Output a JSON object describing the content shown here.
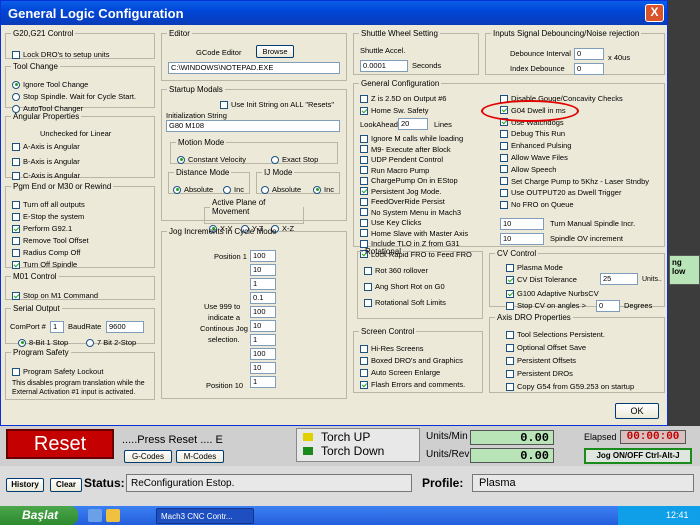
{
  "title": "General Logic Configuration",
  "close_label": "X",
  "g20": {
    "legend": "G20,G21 Control",
    "lock_dro": "Lock DRO's to setup units"
  },
  "toolchange": {
    "legend": "Tool Change",
    "ignore": "Ignore Tool Change",
    "stop": "Stop Spindle. Wait for Cycle Start.",
    "auto": "AutoTool Changer"
  },
  "angular": {
    "legend": "Angular Properties",
    "note": "Unchecked for Linear",
    "a": "A-Axis is Angular",
    "b": "B-Axis is Angular",
    "c": "C-Axis is Angular"
  },
  "pgmend": {
    "legend": "Pgm End or M30 or Rewind",
    "items": [
      "Turn off all outputs",
      "E-Stop the system",
      "Perform G92.1",
      "Remove Tool Offset",
      "Radius Comp Off",
      "Turn Off Spindle"
    ]
  },
  "m01": {
    "legend": "M01 Control",
    "stop": "Stop on M1 Command"
  },
  "serial": {
    "legend": "Serial Output",
    "comport_label": "ComPort #",
    "comport": "1",
    "baud_label": "BaudRate",
    "baud": "9600",
    "bit8": "8-Bit 1 Stop",
    "bit7": "7 Bit 2-Stop"
  },
  "safety": {
    "legend": "Program Safety",
    "lockout": "Program Safety Lockout",
    "desc1": "This disables program translation while the",
    "desc2": "External Activation #1 input is activated."
  },
  "editor": {
    "legend": "Editor",
    "label": "GCode Editor",
    "browse": "Browse",
    "path": "C:\\WINDOWS\\NOTEPAD.EXE"
  },
  "startup": {
    "legend": "Startup Modals",
    "use_init": "Use Init String on ALL \"Resets\"",
    "init_label": "Initialization String",
    "init_value": "G80 M108"
  },
  "motion": {
    "legend": "Motion Mode",
    "cv": "Constant Velocity",
    "exact": "Exact Stop"
  },
  "distance": {
    "legend": "Distance Mode",
    "abs": "Absolute",
    "inc": "Inc"
  },
  "ij": {
    "legend": "IJ Mode",
    "abs": "Absolute",
    "inc": "Inc"
  },
  "plane": {
    "legend": "Active Plane of Movement",
    "xy": "X-Y",
    "yz": "Y-Z",
    "xz": "X-Z"
  },
  "jog": {
    "legend": "Jog Increments in Cycle Mode",
    "pos1": "Position 1",
    "pos10": "Position 10",
    "note1": "Use 999 to",
    "note2": "indicate a",
    "note3": "Continous Jog",
    "note4": "selection.",
    "values": [
      "100",
      "10",
      "1",
      "0.1",
      "100",
      "10",
      "1",
      "100",
      "10",
      "1"
    ]
  },
  "shuttle": {
    "legend": "Shuttle Wheel Setting",
    "accel": "Shuttle Accel.",
    "value": "0.0001",
    "unit": "Seconds"
  },
  "debounce": {
    "legend": "Inputs Signal Debouncing/Noise rejection",
    "interval": "Debounce Interval",
    "interval_val": "0",
    "unit": "x 40us",
    "index": "Index Debounce",
    "index_val": "0"
  },
  "general": {
    "legend": "General Configuration",
    "z25": "Z is 2.5D on Output #6",
    "home_safety": "Home Sw. Safety",
    "lookahead": "LookAhead",
    "lookahead_val": "20",
    "lines": "Lines",
    "left": [
      "Ignore M calls while loading",
      "M9- Execute after Block",
      "UDP Pendent Control",
      "Run Macro Pump",
      "ChargePump On in EStop",
      "Persistent Jog Mode.",
      "FeedOverRide Persist",
      "No System Menu in Mach3",
      "Use Key Clicks",
      "Home Slave with Master Axis",
      "Include TLO in Z from G31",
      "Lock Rapid FRO to Feed FRO"
    ],
    "right": [
      "Disable Gouge/Concavity Checks",
      "G04 Dwell in ms",
      "Use Watchdogs",
      "Debug This Run",
      "Enhanced Pulsing",
      "Allow Wave Files",
      "Allow Speech",
      "Set Charge Pump to 5Khz - Laser Stndby",
      "Use OUTPUT20 as Dwell Trigger",
      "No FRO on Queue"
    ],
    "spindle_incr_val": "10",
    "spindle_incr": "Turn Manual Spindle Incr.",
    "spindle_ov_val": "10",
    "spindle_ov": "Spindle OV increment"
  },
  "rotational": {
    "legend": "Rotational",
    "r360": "Rot 360 rollover",
    "ang": "Ang Short Rot on G0",
    "soft": "Rotational Soft Limits"
  },
  "screen": {
    "legend": "Screen Control",
    "hires": "Hi-Res Screens",
    "boxed": "Boxed DRO's and Graphics",
    "auto": "Auto Screen Enlarge",
    "flash": "Flash Errors and comments."
  },
  "cv": {
    "legend": "CV Control",
    "plasma": "Plasma Mode",
    "dist": "CV Dist Tolerance",
    "dist_val": "25",
    "units": "Units..",
    "g100": "G100 Adaptive NurbsCV",
    "stop": "Stop CV on angles >",
    "stop_val": "0",
    "degrees": "Degrees"
  },
  "axisdro": {
    "legend": "Axis DRO Properties",
    "items": [
      "Tool Selections Persistent.",
      "Optional Offset Save",
      "Persistent Offsets",
      "Persistent DROs",
      "Copy G54 from G59.253 on startup"
    ]
  },
  "ok": "OK",
  "main": {
    "reset": "Reset",
    "press_reset": ".....Press Reset .... E",
    "gcodes": "G-Codes",
    "mcodes": "M-Codes",
    "torch_up": "Torch UP",
    "torch_down": "Torch Down",
    "units_min": "Units/Min",
    "units_rev": "Units/Rev",
    "units_min_val": "0.00",
    "units_rev_val": "0.00",
    "elapsed": "Elapsed",
    "elapsed_val": "00:00:00",
    "jog": "Jog ON/OFF Ctrl-Alt-J",
    "history": "History",
    "clear": "Clear",
    "status_label": "Status:",
    "status": "ReConfiguration Estop.",
    "profile_label": "Profile:",
    "profile": "Plasma",
    "side1": "ng",
    "side2": "low"
  },
  "taskbar": {
    "start": "Başlat",
    "app": "Mach3 CNC Contr...",
    "clock": "12:41"
  },
  "colors": {
    "title_blue": "#0046d8",
    "lcd_green": "#b8e4b8",
    "reset_red": "#c00000",
    "highlight": "#e00000"
  }
}
